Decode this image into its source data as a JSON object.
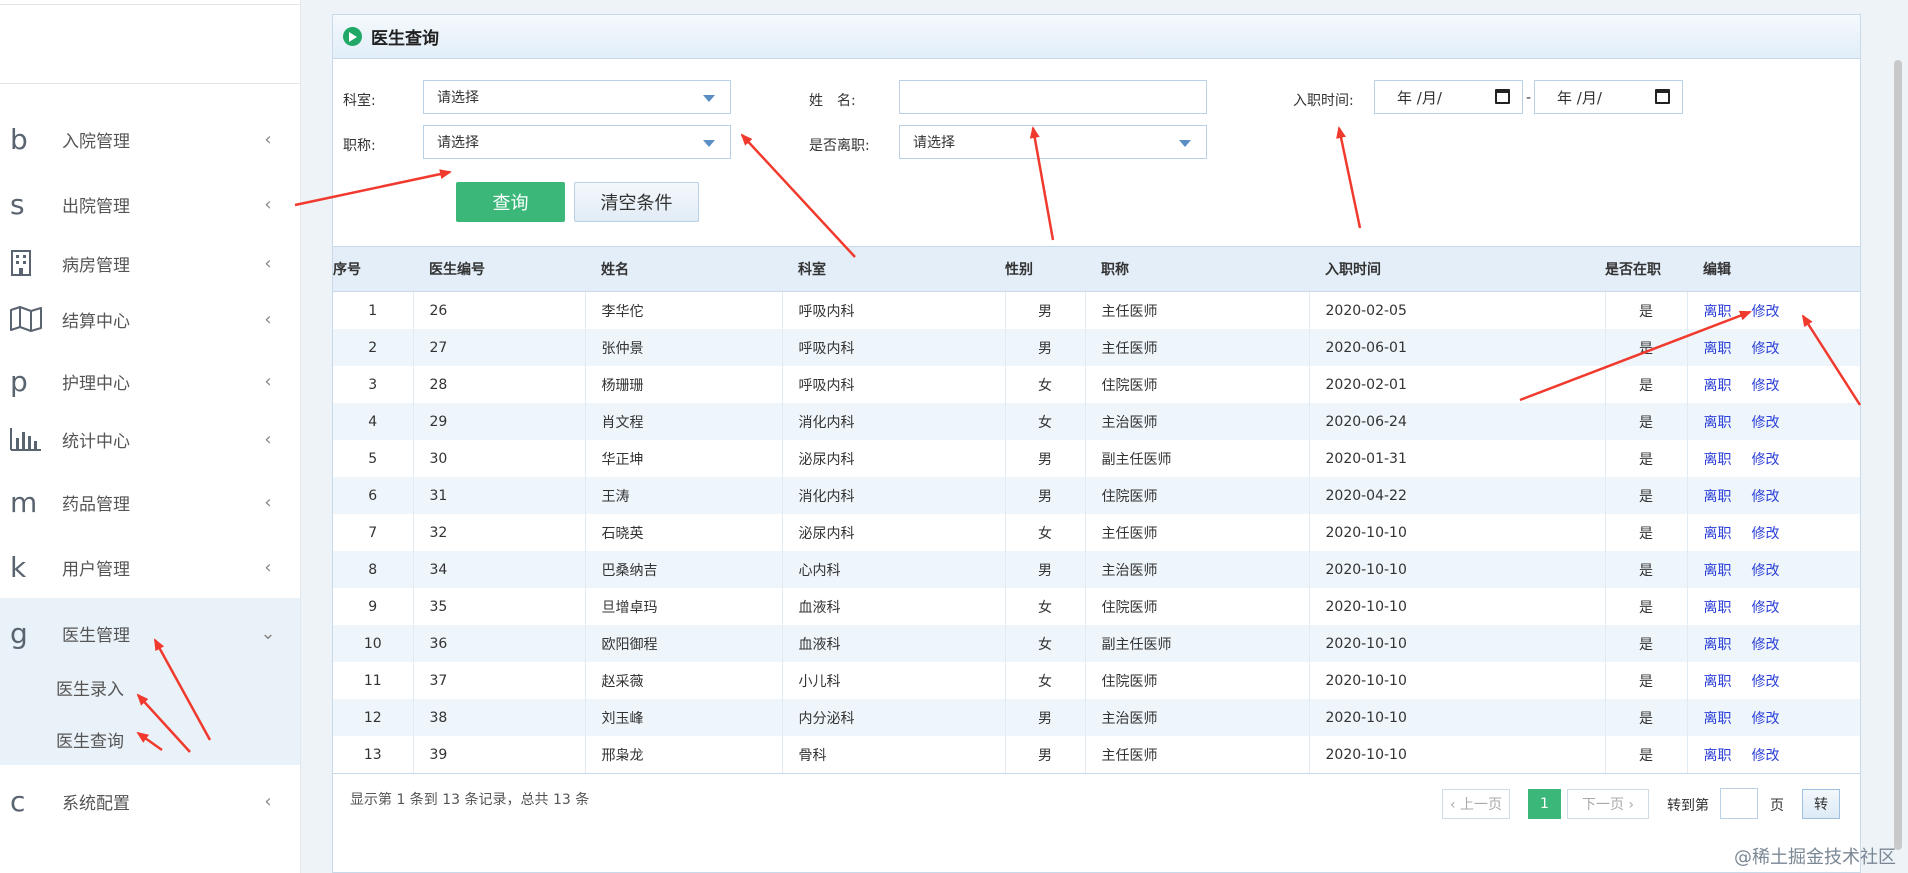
{
  "sidebar": {
    "items": [
      {
        "icon_char": "b",
        "label": "入院管理",
        "arrow": "‹"
      },
      {
        "icon_char": "s",
        "label": "出院管理",
        "arrow": "‹"
      },
      {
        "icon_char": "",
        "label": "病房管理",
        "arrow": "‹"
      },
      {
        "icon_char": "",
        "label": "结算中心",
        "arrow": "‹"
      },
      {
        "icon_char": "p",
        "label": "护理中心",
        "arrow": "‹"
      },
      {
        "icon_char": "",
        "label": "统计中心",
        "arrow": "‹"
      },
      {
        "icon_char": "m",
        "label": "药品管理",
        "arrow": "‹"
      },
      {
        "icon_char": "k",
        "label": "用户管理",
        "arrow": "‹"
      },
      {
        "icon_char": "g",
        "label": "医生管理",
        "arrow": "⌄"
      },
      {
        "icon_char": "c",
        "label": "系统配置",
        "arrow": "‹"
      }
    ],
    "sub_items": [
      "医生录入",
      "医生查询"
    ]
  },
  "panel": {
    "title": "医生查询"
  },
  "filters": {
    "dept_label": "科室:",
    "dept_value": "请选择",
    "title_label": "职称:",
    "title_value": "请选择",
    "name_label": "姓　名:",
    "name_value": "",
    "resigned_label": "是否离职:",
    "resigned_value": "请选择",
    "hire_label": "入职时间:",
    "date_from": "年 /月/",
    "date_sep": "-",
    "date_to": "年 /月/",
    "query_btn": "查询",
    "clear_btn": "清空条件"
  },
  "table": {
    "headers": [
      "序号",
      "医生编号",
      "姓名",
      "科室",
      "性别",
      "职称",
      "入职时间",
      "是否在职",
      "编辑"
    ],
    "action_resign": "离职",
    "action_edit": "修改",
    "rows": [
      [
        "1",
        "26",
        "李华佗",
        "呼吸内科",
        "男",
        "主任医师",
        "2020-02-05",
        "是"
      ],
      [
        "2",
        "27",
        "张仲景",
        "呼吸内科",
        "男",
        "主任医师",
        "2020-06-01",
        "是"
      ],
      [
        "3",
        "28",
        "杨珊珊",
        "呼吸内科",
        "女",
        "住院医师",
        "2020-02-01",
        "是"
      ],
      [
        "4",
        "29",
        "肖文程",
        "消化内科",
        "女",
        "主治医师",
        "2020-06-24",
        "是"
      ],
      [
        "5",
        "30",
        "华正坤",
        "泌尿内科",
        "男",
        "副主任医师",
        "2020-01-31",
        "是"
      ],
      [
        "6",
        "31",
        "王涛",
        "消化内科",
        "男",
        "住院医师",
        "2020-04-22",
        "是"
      ],
      [
        "7",
        "32",
        "石晓英",
        "泌尿内科",
        "女",
        "主任医师",
        "2020-10-10",
        "是"
      ],
      [
        "8",
        "34",
        "巴桑纳吉",
        "心内科",
        "男",
        "主治医师",
        "2020-10-10",
        "是"
      ],
      [
        "9",
        "35",
        "旦增卓玛",
        "血液科",
        "女",
        "住院医师",
        "2020-10-10",
        "是"
      ],
      [
        "10",
        "36",
        "欧阳御程",
        "血液科",
        "女",
        "副主任医师",
        "2020-10-10",
        "是"
      ],
      [
        "11",
        "37",
        "赵采薇",
        "小儿科",
        "女",
        "住院医师",
        "2020-10-10",
        "是"
      ],
      [
        "12",
        "38",
        "刘玉峰",
        "内分泌科",
        "男",
        "主治医师",
        "2020-10-10",
        "是"
      ],
      [
        "13",
        "39",
        "邢枭龙",
        "骨科",
        "男",
        "主任医师",
        "2020-10-10",
        "是"
      ]
    ]
  },
  "pagination": {
    "info": "显示第 1 条到 13 条记录，总共 13 条",
    "prev": "‹ 上一页",
    "current": "1",
    "next": "下一页 ›",
    "goto_label": "转到第",
    "goto_value": "",
    "page_unit": "页",
    "goto_btn": "转"
  },
  "watermark": "@稀土掘金技术社区",
  "colors": {
    "accent_green": "#3bb879",
    "link_blue": "#2b3fd8",
    "annotation_red": "#f03a2e"
  }
}
